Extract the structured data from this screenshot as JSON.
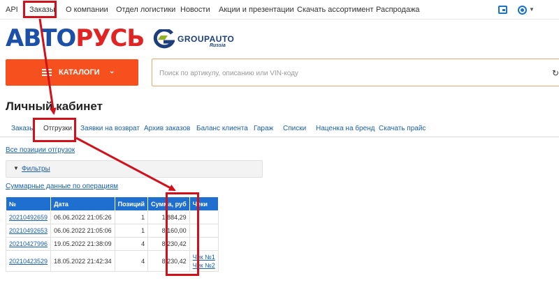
{
  "topnav": {
    "items": [
      "API",
      "Заказы",
      "О компании",
      "Отдел логистики",
      "Новости",
      "Акции и презентации",
      "Скачать ассортимент",
      "Распродажа"
    ]
  },
  "logos": {
    "avto_part1": "АВТО",
    "avto_part2": "РУСЬ",
    "groupauto": "GROUPAUTO",
    "groupauto_sub": "Russia"
  },
  "catalog": {
    "label": "КАТАЛОГИ"
  },
  "search": {
    "placeholder": "Поиск по артикулу, описанию или VIN-коду"
  },
  "page": {
    "title": "Личный кабинет"
  },
  "tabs": [
    "Заказы",
    "Отгрузки",
    "Заявки на возврат",
    "Архив заказов",
    "Баланс клиента",
    "Гараж",
    "Списки",
    "Наценка на бренд",
    "Скачать прайс"
  ],
  "links": {
    "all_positions": "Все позиции отгрузок",
    "filters": "Фильтры",
    "summary": "Суммарные данные по операциям"
  },
  "table": {
    "headers": [
      "№",
      "Дата",
      "Позиций",
      "Сумма, руб",
      "Чеки"
    ],
    "rows": [
      {
        "id": "20210492659",
        "date": "06.06.2022 21:05:26",
        "qty": "1",
        "sum": "1 884,29",
        "receipts": []
      },
      {
        "id": "20210492653",
        "date": "06.06.2022 21:05:06",
        "qty": "1",
        "sum": "8 160,00",
        "receipts": []
      },
      {
        "id": "20210427996",
        "date": "19.05.2022 21:38:09",
        "qty": "4",
        "sum": "8 230,42",
        "receipts": []
      },
      {
        "id": "20210423529",
        "date": "18.05.2022 21:42:34",
        "qty": "4",
        "sum": "8 230,42",
        "receipts": [
          "Чек №1",
          "Чек №2"
        ]
      }
    ]
  },
  "colors": {
    "accent_orange": "#f5501e",
    "header_blue": "#1f6fd1",
    "link_blue": "#1a5fa8",
    "annotation_red": "#d0111c"
  }
}
